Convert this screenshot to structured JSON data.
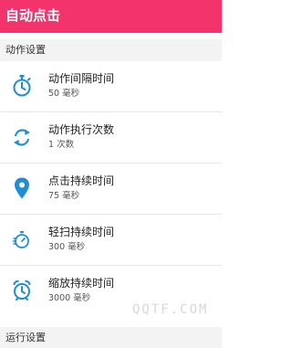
{
  "app": {
    "title": "自动点击"
  },
  "sections": [
    {
      "label": "动作设置"
    },
    {
      "label": "运行设置"
    }
  ],
  "items": [
    {
      "title": "动作间隔时间",
      "value": "50 毫秒",
      "icon": "stopwatch-icon"
    },
    {
      "title": "动作执行次数",
      "value": "1 次数",
      "icon": "repeat-icon"
    },
    {
      "title": "点击持续时间",
      "value": "75 毫秒",
      "icon": "location-pin-icon"
    },
    {
      "title": "轻扫持续时间",
      "value": "300 毫秒",
      "icon": "timer-icon"
    },
    {
      "title": "缩放持续时间",
      "value": "3000 毫秒",
      "icon": "alarm-clock-icon"
    }
  ],
  "watermark": "QQTF.COM",
  "colors": {
    "accent": "#f2336c",
    "icon": "#1e8fd6",
    "section_bg": "#f3f3f3"
  }
}
